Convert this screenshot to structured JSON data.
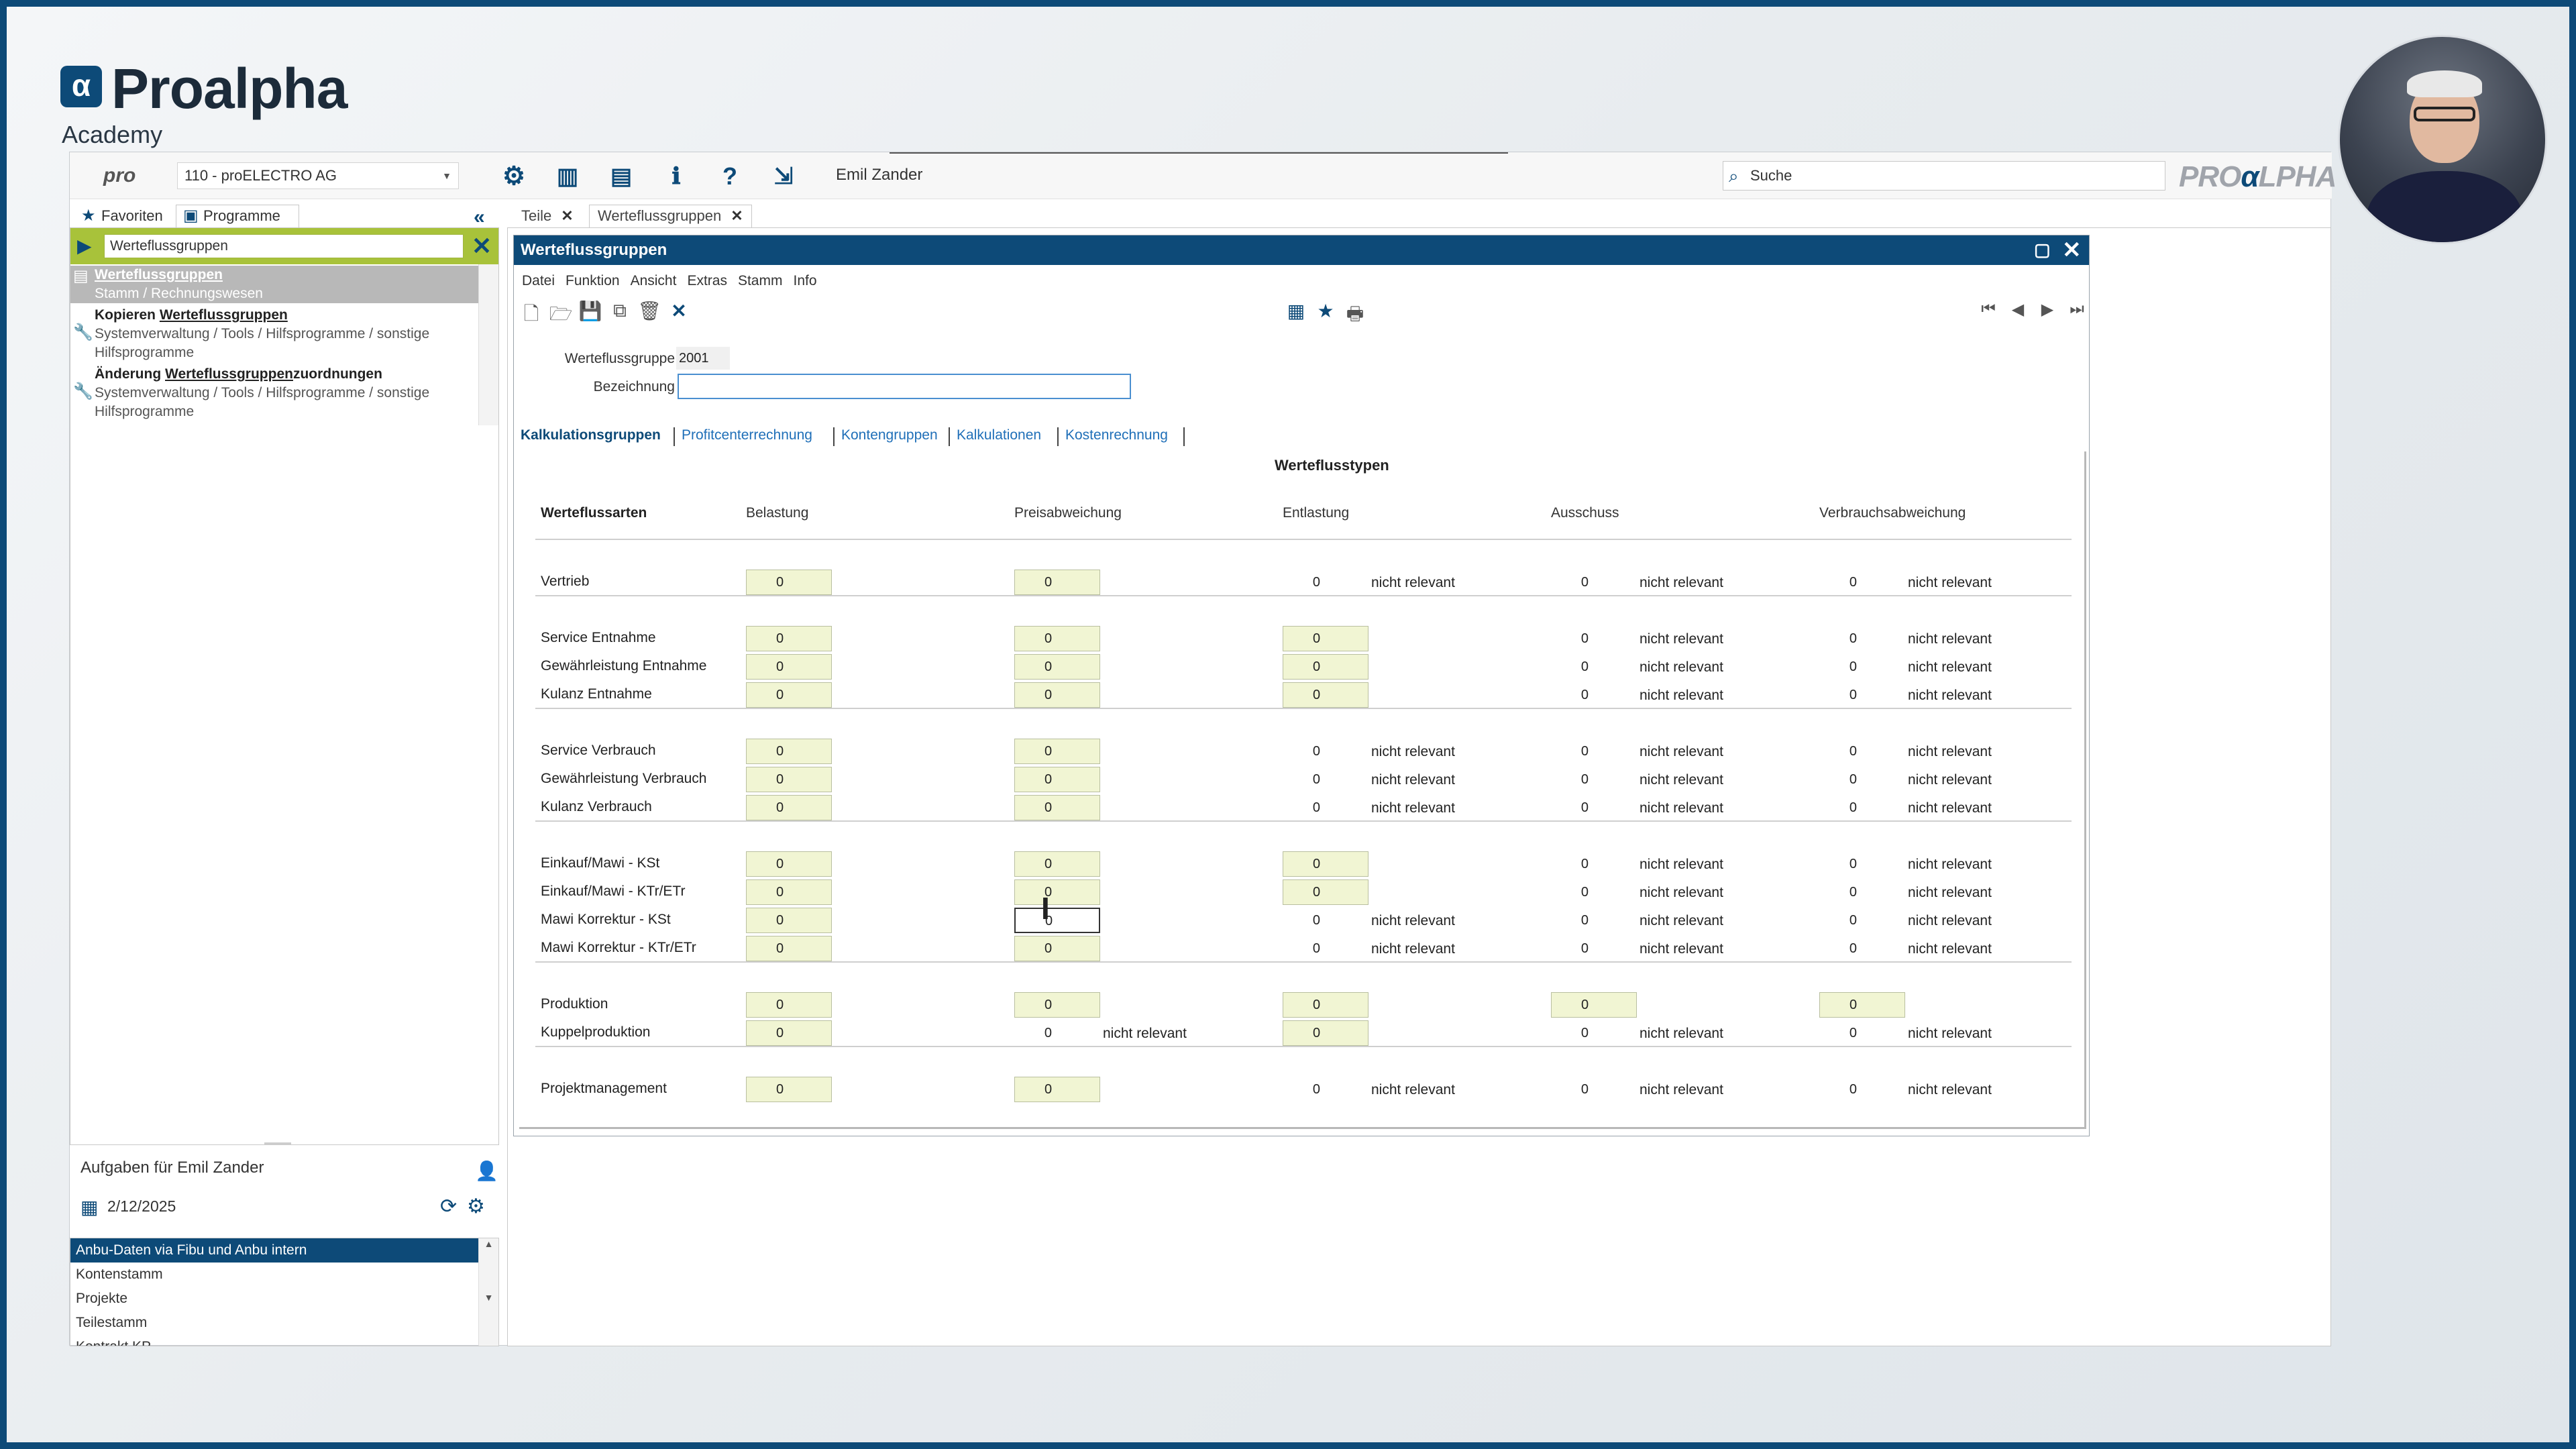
{
  "brand": {
    "name": "Proalpha",
    "mark": "α",
    "academy": "Academy"
  },
  "topbar": {
    "pro_logo": "pro",
    "company": "110 - proELECTRO AG",
    "user": "Emil Zander",
    "search_placeholder": "Suche",
    "logo_pro": "PRO",
    "logo_alpha": "α",
    "logo_lpha": "LPHA"
  },
  "left_tabs": {
    "favoriten": "Favoriten",
    "programme": "Programme"
  },
  "left_search": {
    "value": "Werteflussgruppen"
  },
  "left_results": [
    {
      "title": "Werteflussgruppen",
      "sub": "Stamm / Rechnungswesen"
    },
    {
      "title_prefix": "Kopieren ",
      "title": "Werteflussgruppen",
      "sub1": "Systemverwaltung / Tools / Hilfsprogramme / sonstige",
      "sub2": "Hilfsprogramme"
    },
    {
      "title_prefix": "Änderung ",
      "title": "Werteflussgruppen",
      "title_suffix": "zuordnungen",
      "sub1": "Systemverwaltung / Tools / Hilfsprogramme / sonstige",
      "sub2": "Hilfsprogramme"
    }
  ],
  "tasks": {
    "title": "Aufgaben für Emil Zander",
    "date": "2/12/2025",
    "items": [
      "Anbu-Daten via Fibu und Anbu intern",
      "Kontenstamm",
      "Projekte",
      "Teilestamm",
      "Kontrakt KP"
    ]
  },
  "content_tabs": [
    "Teile",
    "Werteflussgruppen"
  ],
  "dialog": {
    "title": "Werteflussgruppen",
    "menu": [
      "Datei",
      "Funktion",
      "Ansicht",
      "Extras",
      "Stamm",
      "Info"
    ],
    "field_group_label": "Werteflussgruppe",
    "field_group_value": "2001",
    "field_desc_label": "Bezeichnung",
    "field_desc_value": "",
    "subtabs": [
      "Kalkulationsgruppen",
      "Profitcenterrechnung",
      "Kontengruppen",
      "Kalkulationen",
      "Kostenrechnung"
    ],
    "grid_title": "Werteflusstypen",
    "columns": [
      "Werteflussarten",
      "Belastung",
      "Preisabweichung",
      "Entlastung",
      "Ausschuss",
      "Verbrauchsabweichung"
    ],
    "nr": "nicht relevant",
    "zero": "0",
    "rows": [
      "Vertrieb",
      "Service Entnahme",
      "Gewährleistung Entnahme",
      "Kulanz Entnahme",
      "Service Verbrauch",
      "Gewährleistung Verbrauch",
      "Kulanz Verbrauch",
      "Einkauf/Mawi - KSt",
      "Einkauf/Mawi - KTr/ETr",
      "Mawi Korrektur - KSt",
      "Mawi Korrektur - KTr/ETr",
      "Produktion",
      "Kuppelproduktion",
      "Projektmanagement"
    ]
  }
}
